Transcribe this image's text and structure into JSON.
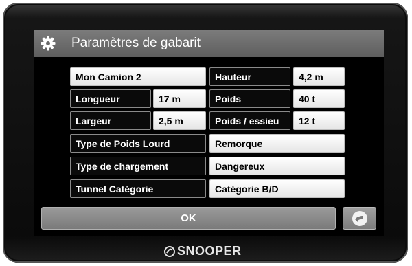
{
  "title": "Paramètres de gabarit",
  "profile": {
    "name": "Mon Camion 2"
  },
  "fields": {
    "hauteur": {
      "label": "Hauteur",
      "value": "4,2 m"
    },
    "longueur": {
      "label": "Longueur",
      "value": "17 m"
    },
    "poids": {
      "label": "Poids",
      "value": "40 t"
    },
    "largeur": {
      "label": "Largeur",
      "value": "2,5 m"
    },
    "poids_essieu": {
      "label": "Poids / essieu",
      "value": "12 t"
    },
    "type_poids_lourd": {
      "label": "Type de Poids Lourd",
      "value": "Remorque"
    },
    "type_chargement": {
      "label": "Type de chargement",
      "value": "Dangereux"
    },
    "tunnel_categorie": {
      "label": "Tunnel Catégorie",
      "value": "Catégorie B/D"
    }
  },
  "buttons": {
    "ok": "OK",
    "back_icon": "back-arrow-icon"
  },
  "header": {
    "icon": "gear-icon"
  },
  "brand": {
    "logo": "SNOOPER",
    "mark_icon": "snooper-logo-icon"
  },
  "colors": {
    "title_bar": "#6e6e6e",
    "screen_bg": "#000000",
    "button_bg": "#8a8a8a"
  }
}
